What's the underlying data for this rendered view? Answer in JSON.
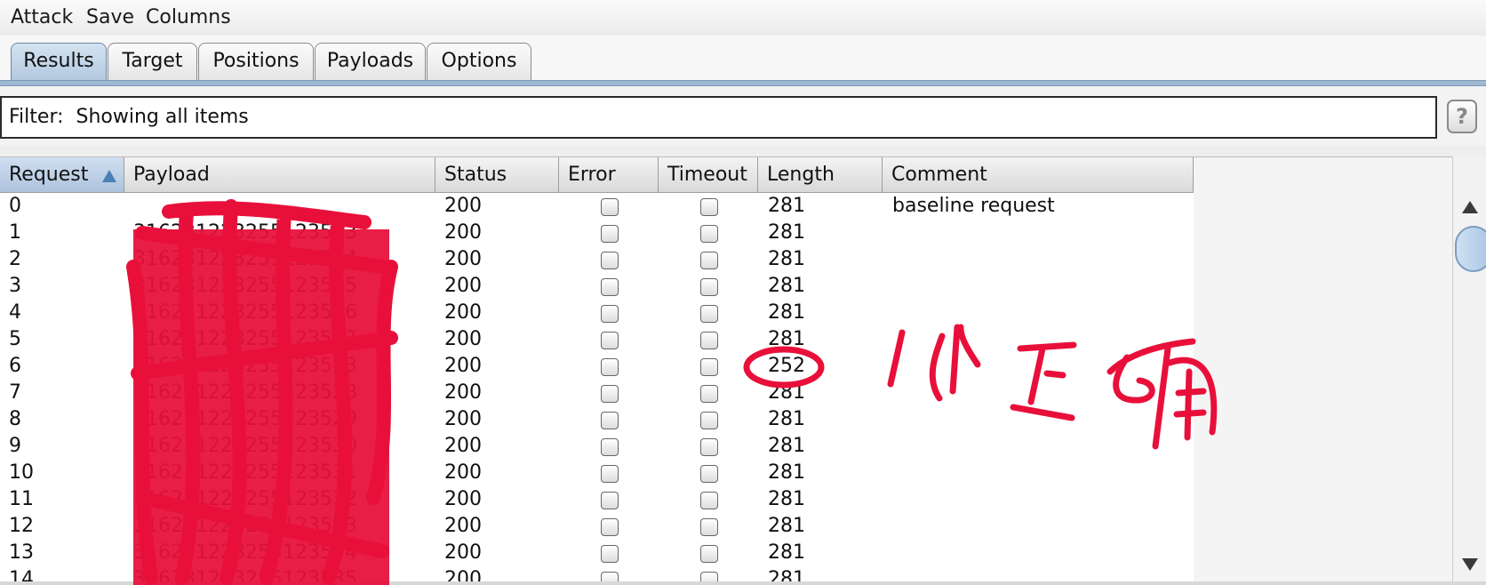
{
  "menu": {
    "items": [
      "Attack",
      "Save",
      "Columns"
    ]
  },
  "tabs": [
    {
      "label": "Results",
      "selected": true
    },
    {
      "label": "Target"
    },
    {
      "label": "Positions"
    },
    {
      "label": "Payloads"
    },
    {
      "label": "Options"
    }
  ],
  "filter": {
    "label": "Filter:",
    "text": "Showing all items",
    "help": "?"
  },
  "table": {
    "columns": [
      "Request",
      "Payload",
      "Status",
      "Error",
      "Timeout",
      "Length",
      "Comment"
    ],
    "sorted_column": "Request",
    "rows": [
      {
        "request": "0",
        "payload": "",
        "status": "200",
        "length": "281",
        "comment": "baseline request"
      },
      {
        "request": "1",
        "payload": "316231223255123523",
        "status": "200",
        "length": "281",
        "comment": ""
      },
      {
        "request": "2",
        "payload": "316231223255123524",
        "status": "200",
        "length": "281",
        "comment": ""
      },
      {
        "request": "3",
        "payload": "316231223255123525",
        "status": "200",
        "length": "281",
        "comment": ""
      },
      {
        "request": "4",
        "payload": "316231223255123526",
        "status": "200",
        "length": "281",
        "comment": ""
      },
      {
        "request": "5",
        "payload": "316231223255123527",
        "status": "200",
        "length": "281",
        "comment": ""
      },
      {
        "request": "6",
        "payload": "316231223255123533",
        "status": "200",
        "length": "252",
        "comment": ""
      },
      {
        "request": "7",
        "payload": "316231223255123528",
        "status": "200",
        "length": "281",
        "comment": ""
      },
      {
        "request": "8",
        "payload": "316231223255123529",
        "status": "200",
        "length": "281",
        "comment": ""
      },
      {
        "request": "9",
        "payload": "316231223255123530",
        "status": "200",
        "length": "281",
        "comment": ""
      },
      {
        "request": "10",
        "payload": "316231223255123531",
        "status": "200",
        "length": "281",
        "comment": ""
      },
      {
        "request": "11",
        "payload": "316231223255123532",
        "status": "200",
        "length": "281",
        "comment": ""
      },
      {
        "request": "12",
        "payload": "316231223255123533",
        "status": "200",
        "length": "281",
        "comment": ""
      },
      {
        "request": "13",
        "payload": "316231223255123534",
        "status": "200",
        "length": "281",
        "comment": ""
      },
      {
        "request": "14",
        "payload": "316231223255123535",
        "status": "200",
        "length": "281",
        "comment": ""
      }
    ]
  },
  "annotation": {
    "text": "1个正确",
    "color": "#e8103a"
  }
}
